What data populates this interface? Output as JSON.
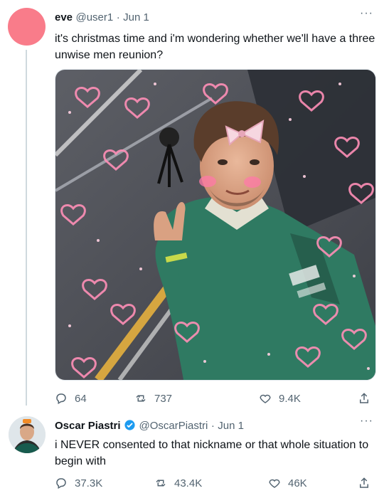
{
  "tweet1": {
    "name": "eve",
    "handle": "@user1",
    "sep": "·",
    "date": "Jun 1",
    "text": "it's christmas time and i'm wondering whether we'll have a three unwise men reunion?",
    "more": "···",
    "actions": {
      "replies": "64",
      "retweets": "737",
      "likes": "9.4K"
    }
  },
  "tweet2": {
    "name": "Oscar Piastri",
    "handle": "@OscarPiastri",
    "sep": "·",
    "date": "Jun 1",
    "text": "i NEVER consented to that nickname or that whole situation to begin with",
    "more": "···",
    "actions": {
      "replies": "37.3K",
      "retweets": "43.4K",
      "likes": "46K"
    }
  },
  "colors": {
    "accent": "#1d9bf0",
    "muted": "#536471",
    "avatar_pink": "#f97c8a",
    "jacket_green": "#2f7a62"
  }
}
